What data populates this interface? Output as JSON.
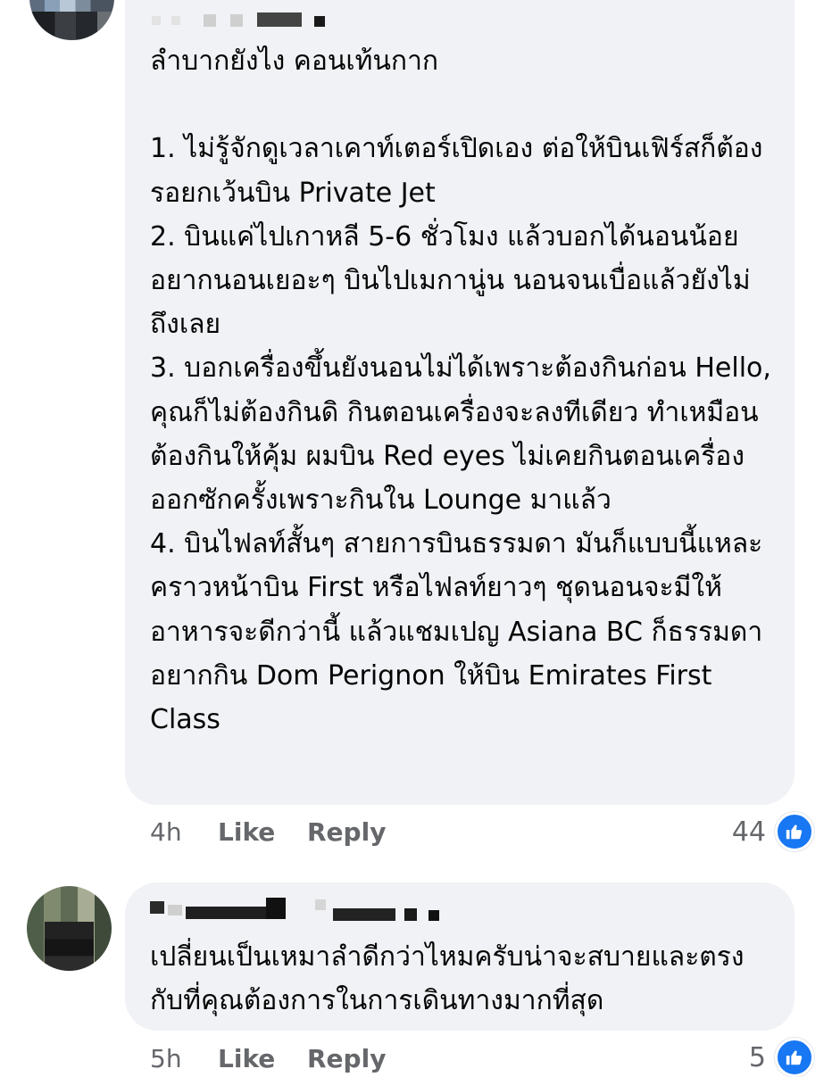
{
  "comments": [
    {
      "text": "ลำบากยังไง คอนเท้นกาก\n\n1. ไม่รู้จักดูเวลาเคาท์เตอร์เปิดเอง ต่อให้บินเฟิร์สก็ต้องรอยกเว้นบิน Private Jet\n2. บินแค่ไปเกาหลี 5-6 ชั่วโมง แล้วบอกได้นอนน้อย อยากนอนเยอะๆ บินไปเมกานู่น นอนจนเบื่อแล้วยังไม่ถึงเลย\n3. บอกเครื่องขึ้นยังนอนไม่ได้เพราะต้องกินก่อน Hello, คุณก็ไม่ต้องกินดิ กินตอนเครื่องจะลงทีเดียว ทำเหมือนต้องกินให้คุ้ม ผมบิน Red eyes ไม่เคยกินตอนเครื่องออกซักครั้งเพราะกินใน Lounge มาแล้ว\n4. บินไฟลท์สั้นๆ สายการบินธรรมดา มันก็แบบนี้แหละ คราวหน้าบิน First หรือไฟลท์ยาวๆ ชุดนอนจะมีให้ อาหารจะดีกว่านี้ แล้วแชมเปญ Asiana BC ก็ธรรมดา อยากกิน Dom Perignon ให้บิน Emirates First Class",
      "time": "4h",
      "like_label": "Like",
      "reply_label": "Reply",
      "reaction_count": "44",
      "reaction_icon": "thumbs-up-icon"
    },
    {
      "text": "เปลี่ยนเป็นเหมาลำดีกว่าไหมครับน่าจะสบายและตรงกับที่คุณต้องการในการเดินทางมากที่สุด",
      "time": "5h",
      "like_label": "Like",
      "reply_label": "Reply",
      "reaction_count": "5",
      "reaction_icon": "thumbs-up-icon"
    }
  ],
  "colors": {
    "bubble": "#f0f2f5",
    "meta_text": "#65676b",
    "like_badge": "#1877f2"
  }
}
